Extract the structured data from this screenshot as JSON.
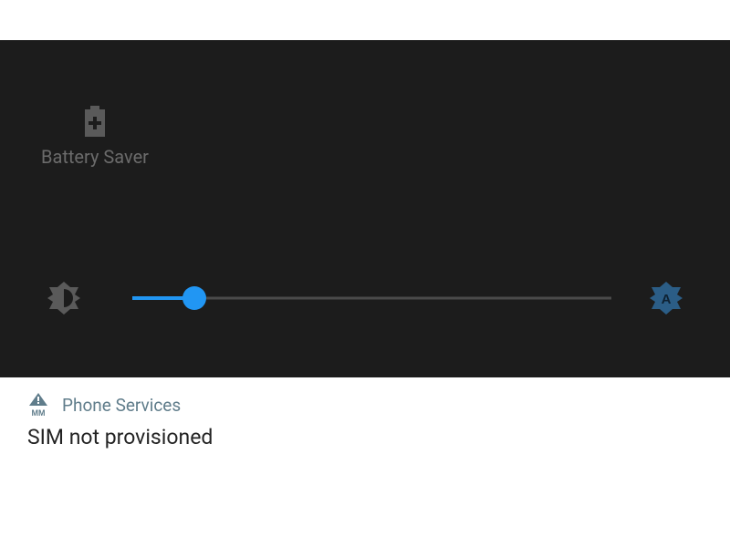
{
  "quick_settings": {
    "tiles": [
      {
        "label": "Battery Saver",
        "icon": "battery-plus-icon"
      }
    ],
    "brightness": {
      "low_icon": "brightness-low-icon",
      "auto_icon": "auto-brightness-icon",
      "auto_label": "A",
      "value_percent": 13
    }
  },
  "notification": {
    "app_icon": "warning-sim-icon",
    "app_icon_sub": "MM",
    "app_name": "Phone Services",
    "title": "SIM not provisioned"
  },
  "colors": {
    "accent": "#2196f3",
    "panel_bg": "#1c1c1c",
    "dim": "#6b6b6b",
    "notif_accent": "#607d8b"
  }
}
